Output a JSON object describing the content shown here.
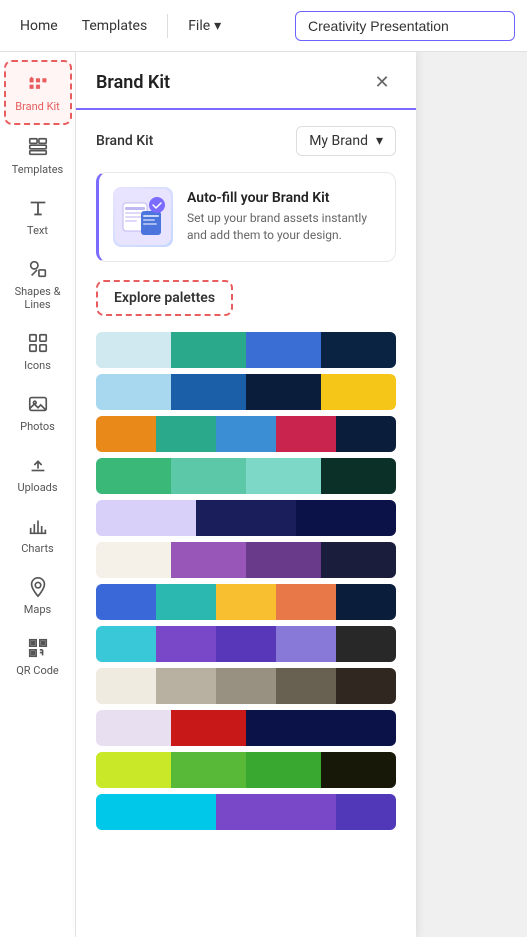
{
  "topNav": {
    "home": "Home",
    "templates": "Templates",
    "file": "File",
    "fileChevron": "▾",
    "titlePlaceholder": "Creativity Presentation"
  },
  "sidebar": {
    "items": [
      {
        "id": "brand-kit",
        "label": "Brand Kit",
        "active": true
      },
      {
        "id": "templates",
        "label": "Templates",
        "active": false
      },
      {
        "id": "text",
        "label": "Text",
        "active": false
      },
      {
        "id": "shapes-lines",
        "label": "Shapes & Lines",
        "active": false
      },
      {
        "id": "icons",
        "label": "Icons",
        "active": false
      },
      {
        "id": "photos",
        "label": "Photos",
        "active": false
      },
      {
        "id": "uploads",
        "label": "Uploads",
        "active": false
      },
      {
        "id": "charts",
        "label": "Charts",
        "active": false
      },
      {
        "id": "maps",
        "label": "Maps",
        "active": false
      },
      {
        "id": "qr-code",
        "label": "QR Code",
        "active": false
      }
    ]
  },
  "panel": {
    "title": "Brand Kit",
    "brandKitLabel": "Brand Kit",
    "brandKitValue": "My Brand",
    "autofill": {
      "title": "Auto-fill your Brand Kit",
      "description": "Set up your brand assets instantly and add them to your design."
    },
    "explorePalettesLabel": "Explore palettes",
    "palettes": [
      [
        "#d0e8f0",
        "#2aaa8a",
        "#3b6ed4",
        "#0a2342"
      ],
      [
        "#a8d8f0",
        "#1a5fa8",
        "#0a1e3c",
        "#f5c518"
      ],
      [
        "#e8891a",
        "#2aaa8a",
        "#3b8ed4",
        "#c8244e",
        "#0a1e3c"
      ],
      [
        "#3ab878",
        "#5dc8a8",
        "#7ed8c8",
        "#0a3028"
      ],
      [
        "#d8d0f8",
        "#1a1e5a",
        "#0a1248"
      ],
      [
        "#f5f0e8",
        "#9856b8",
        "#6a3a8a",
        "#1a1e3c"
      ],
      [
        "#3a68d8",
        "#2ab8b0",
        "#f8c030",
        "#e87848",
        "#0a1e3c"
      ],
      [
        "#38c8d8",
        "#7848c8",
        "#5838b8",
        "#8878d8",
        "#282828"
      ],
      [
        "#f0ebe0",
        "#b8b0a0",
        "#989080",
        "#686050",
        "#302820"
      ],
      [
        "#e8dff0",
        "#c81818",
        "#0a1248",
        "#0a1248"
      ],
      [
        "#c8e828",
        "#58b838",
        "#38a830",
        "#181808"
      ]
    ]
  }
}
